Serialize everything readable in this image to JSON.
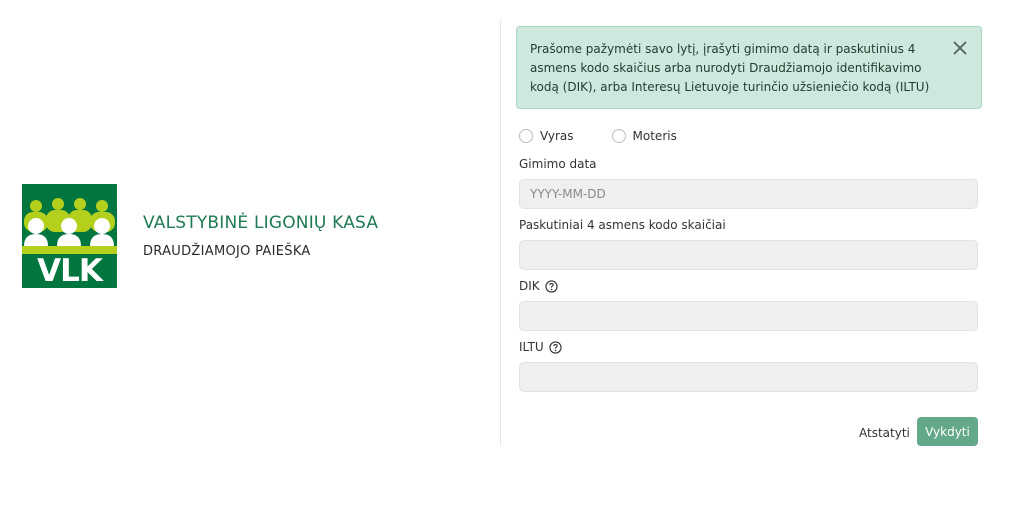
{
  "brand": {
    "logo_text": "VLK",
    "title": "VALSTYBINĖ LIGONIŲ KASA",
    "subtitle": "DRAUDŽIAMOJO PAIEŠKA",
    "colors": {
      "dark_green": "#00763f",
      "lime": "#b5cf1d",
      "title_green": "#1e7a52"
    }
  },
  "alert": {
    "text": "Prašome pažymėti savo lytį, įrašyti gimimo datą ir paskutinius 4 asmens kodo skaičius arba nurodyti Draudžiamojo identifikavimo kodą (DIK), arba Interesų Lietuvoje turinčio užsieniečio kodą (ILTU)",
    "close_icon": "close-icon",
    "background": "#cfe8dd"
  },
  "gender": {
    "options": [
      "Vyras",
      "Moteris"
    ]
  },
  "fields": {
    "birth_date": {
      "label": "Gimimo data",
      "placeholder": "YYYY-MM-DD",
      "value": ""
    },
    "last_digits": {
      "label": "Paskutiniai 4 asmens kodo skaičiai",
      "placeholder": "",
      "value": ""
    },
    "dik": {
      "label": "DIK",
      "placeholder": "",
      "value": "",
      "help_icon": "question-circle-icon"
    },
    "iltu": {
      "label": "ILTU",
      "placeholder": "",
      "value": "",
      "help_icon": "question-circle-icon"
    }
  },
  "actions": {
    "reset_label": "Atstatyti",
    "submit_label": "Vykdyti",
    "submit_color": "#64a88a"
  }
}
